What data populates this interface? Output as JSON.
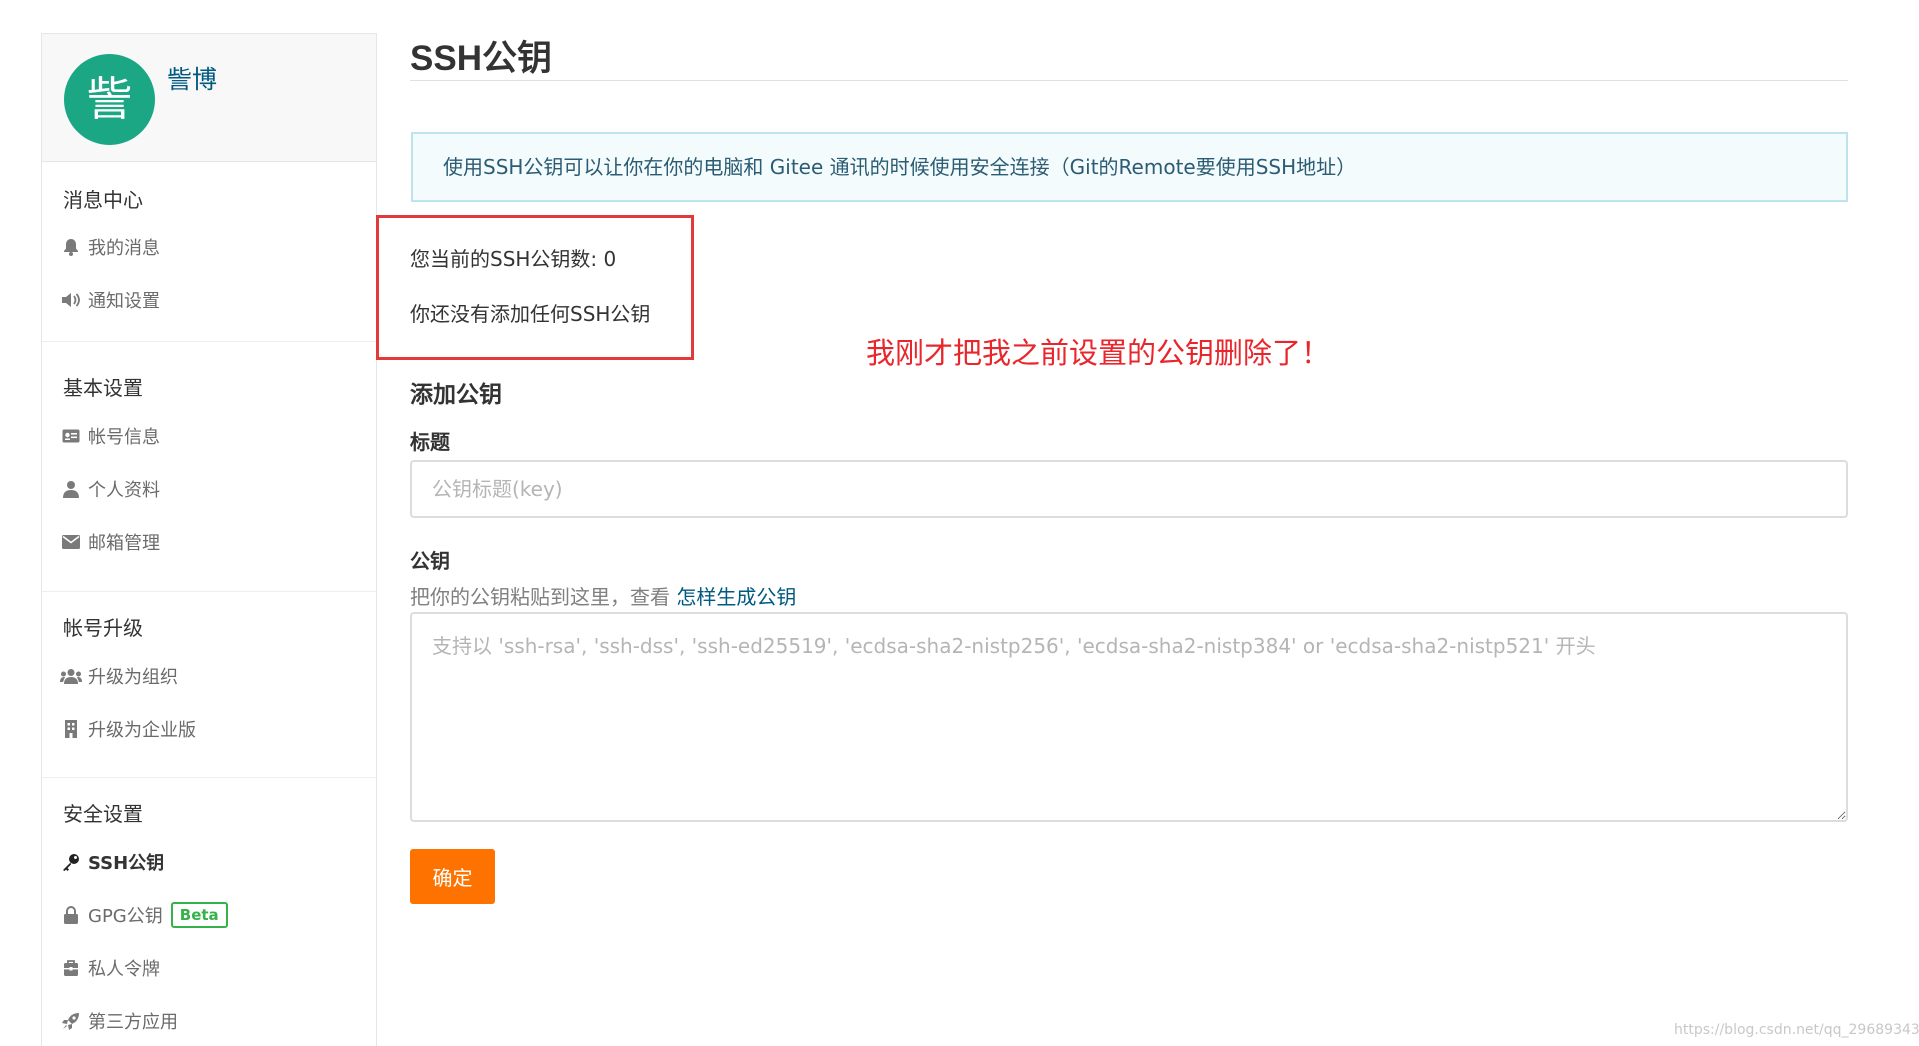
{
  "sidebar": {
    "avatar_char": "訾",
    "username": "訾博",
    "sections": [
      {
        "title": "消息中心",
        "items": [
          {
            "label": "我的消息",
            "icon": "bell-icon"
          },
          {
            "label": "通知设置",
            "icon": "speaker-icon"
          }
        ]
      },
      {
        "title": "基本设置",
        "items": [
          {
            "label": "帐号信息",
            "icon": "id-card-icon"
          },
          {
            "label": "个人资料",
            "icon": "user-icon"
          },
          {
            "label": "邮箱管理",
            "icon": "envelope-icon"
          }
        ]
      },
      {
        "title": "帐号升级",
        "items": [
          {
            "label": "升级为组织",
            "icon": "users-icon"
          },
          {
            "label": "升级为企业版",
            "icon": "building-icon"
          }
        ]
      },
      {
        "title": "安全设置",
        "items": [
          {
            "label": "SSH公钥",
            "icon": "key-icon",
            "active": true
          },
          {
            "label": "GPG公钥",
            "icon": "lock-icon",
            "badge": "Beta"
          },
          {
            "label": "私人令牌",
            "icon": "briefcase-icon"
          },
          {
            "label": "第三方应用",
            "icon": "rocket-icon"
          }
        ]
      }
    ]
  },
  "main": {
    "title": "SSH公钥",
    "info": "使用SSH公钥可以让你在你的电脑和 Gitee 通讯的时候使用安全连接（Git的Remote要使用SSH地址）",
    "count_text": "您当前的SSH公钥数: 0",
    "none_text": "你还没有添加任何SSH公钥",
    "annotation": "我刚才把我之前设置的公钥删除了！",
    "add_title": "添加公钥",
    "title_label": "标题",
    "title_placeholder": "公钥标题(key)",
    "key_label": "公钥",
    "key_hint": "把你的公钥粘贴到这里，查看 ",
    "key_hint_link": "怎样生成公钥",
    "key_placeholder": "支持以 'ssh-rsa', 'ssh-dss', 'ssh-ed25519', 'ecdsa-sha2-nistp256', 'ecdsa-sha2-nistp384' or 'ecdsa-sha2-nistp521' 开头",
    "submit_label": "确定"
  },
  "watermark": "https://blog.csdn.net/qq_29689343",
  "colors": {
    "accent_orange": "#fe7300",
    "link_blue": "#005980",
    "avatar_green": "#1ba784",
    "annotation_red": "#e8262b",
    "beta_green": "#35b34a"
  }
}
